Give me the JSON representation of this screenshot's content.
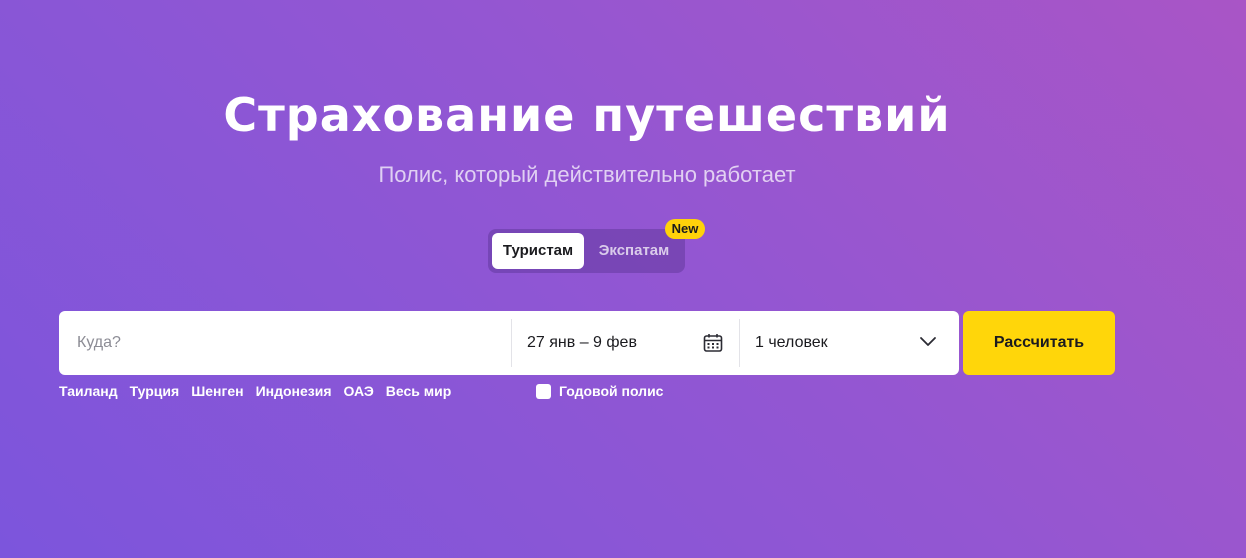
{
  "hero": {
    "title": "Страхование путешествий",
    "subtitle": "Полис, который действительно работает"
  },
  "audience_tabs": [
    {
      "label": "Туристам",
      "active": true
    },
    {
      "label": "Экспатам",
      "active": false
    }
  ],
  "new_badge": "New",
  "search": {
    "destination_placeholder": "Куда?",
    "dates_value": "27 янв – 9 фев",
    "people_value": "1 человек"
  },
  "calculate_button": "Рассчитать",
  "quick_links": [
    "Таиланд",
    "Турция",
    "Шенген",
    "Индонезия",
    "ОАЭ",
    "Весь мир"
  ],
  "annual_policy": {
    "label": "Годовой полис",
    "checked": false
  },
  "icons": {
    "dates": "calendar-icon",
    "people": "chevron-down-icon"
  },
  "colors": {
    "accent": "#ffd60a",
    "background_from": "#7c55dc",
    "background_to": "#a955c6"
  }
}
